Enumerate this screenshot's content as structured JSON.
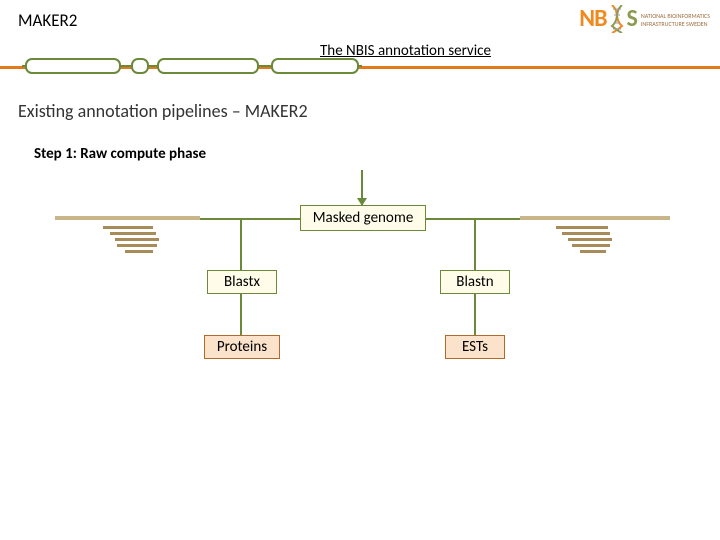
{
  "slide": {
    "title": "MAKER2",
    "service": "The NBIS annotation service",
    "subtitle": "Existing annotation pipelines – MAKER2",
    "step": "Step 1: Raw compute phase"
  },
  "logo": {
    "prefix": "NB",
    "suffix": "S",
    "sub1": "NATIONAL BIOINFORMATICS",
    "sub2": "INFRASTRUCTURE SWEDEN"
  },
  "diagram": {
    "masked": "Masked genome",
    "blastx": "Blastx",
    "blastn": "Blastn",
    "proteins": "Proteins",
    "ests": "ESTs"
  },
  "colors": {
    "orange": "#e07a1a",
    "green_border": "#6a8a3a",
    "green_fill": "#fffde9",
    "peach_border": "#b06a2a",
    "peach_fill": "#fbe2ca"
  }
}
